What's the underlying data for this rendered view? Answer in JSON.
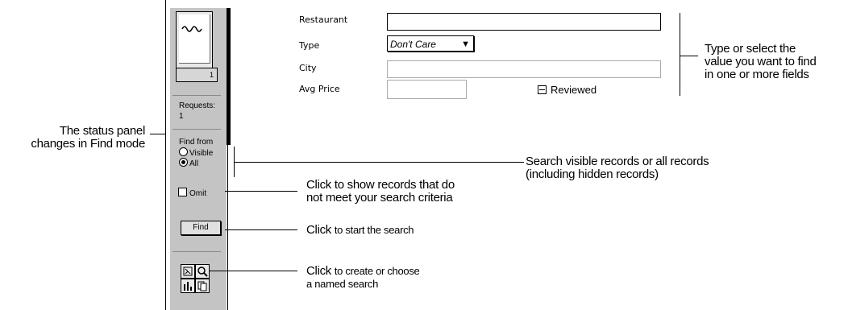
{
  "status_panel": {
    "record_number": "1",
    "requests_label": "Requests:",
    "requests_count": "1",
    "find_from_label": "Find from",
    "radio_visible": "Visible",
    "radio_all": "All",
    "omit_label": "Omit",
    "find_button": "Find"
  },
  "form": {
    "restaurant_label": "Restaurant",
    "type_label": "Type",
    "type_value": "Don't Care",
    "city_label": "City",
    "avg_price_label": "Avg Price",
    "reviewed_label": "Reviewed"
  },
  "callouts": {
    "status_panel": [
      "The status panel",
      "changes in Find mode"
    ],
    "type_select": [
      "Type or select the",
      "value you want to find",
      "in one or more fields"
    ],
    "search_scope": [
      "Search visible records or all records",
      "(including hidden records)"
    ],
    "omit": [
      "Click to show records that do",
      "not meet your search criteria"
    ],
    "find_bold": "Click",
    "find_rest": "to start the search",
    "named_bold": "Click",
    "named_rest1": "to create or choose",
    "named_rest2": "a named search"
  },
  "icons": [
    "layout-tool-icon",
    "magnifier-icon",
    "chart-icon",
    "copy-icon"
  ]
}
